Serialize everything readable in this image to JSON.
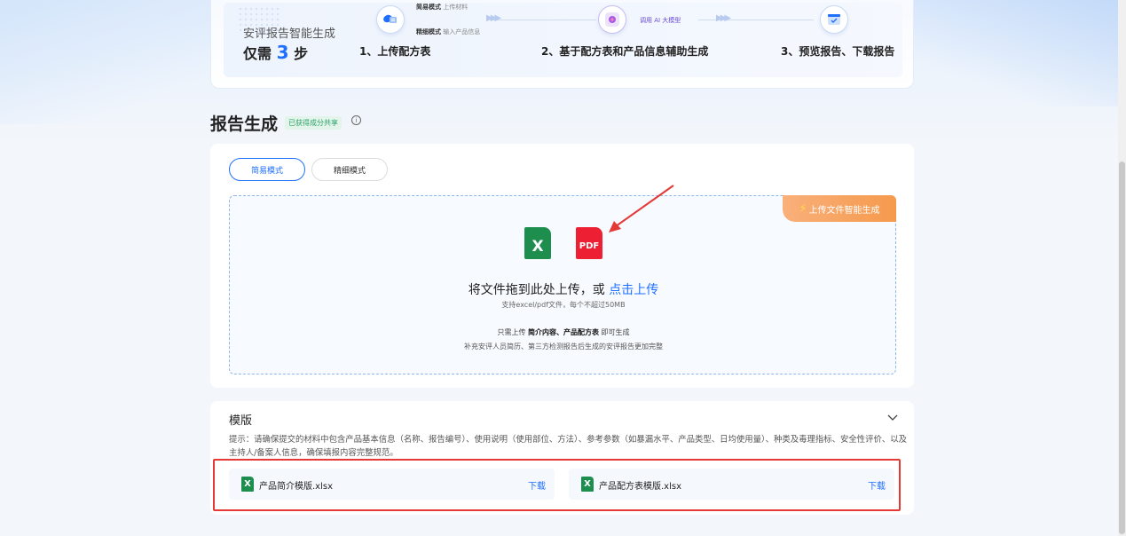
{
  "steps": {
    "title": "安评报告智能生成",
    "subtitle_prefix": "仅需",
    "subtitle_num": "3",
    "subtitle_suffix": "步",
    "step1_label": "1、上传配方表",
    "step2_label": "2、基于配方表和产品信息辅助生成",
    "step3_label": "3、预览报告、下载报告",
    "simple_mode_name": "简易模式",
    "simple_mode_desc": "上传材料",
    "fine_mode_name": "精细模式",
    "fine_mode_desc": "输入产品信息",
    "ai_text": "调用 AI 大模型"
  },
  "heading": {
    "title": "报告生成",
    "badge": "已获得成分共享",
    "info_icon": "i"
  },
  "upload": {
    "mode_simple": "简易模式",
    "mode_fine": "精细模式",
    "corner_tag": "上传文件智能生成",
    "excel_glyph": "X",
    "pdf_glyph": "PDF",
    "main_text": "将文件拖到此处上传，或",
    "main_link": "点击上传",
    "sub_text": "支持excel/pdf文件，每个不超过50MB",
    "note1_prefix": "只需上传",
    "note1_bold": "简介内容、产品配方表",
    "note1_suffix": "即可生成",
    "note2": "补充安评人员简历、第三方检测报告后生成的安评报告更加完整"
  },
  "template": {
    "title": "模版",
    "hint": "提示：请确保提交的材料中包含产品基本信息（名称、报告编号）、使用说明（使用部位、方法）、参考参数（如暴漏水平、产品类型、日均使用量）、种类及毒理指标、安全性评价、以及主持人/备案人信息，确保填报内容完整规范。",
    "files": [
      {
        "name": "产品简介模版.xlsx",
        "action": "下载",
        "icon": "X"
      },
      {
        "name": "产品配方表模版.xlsx",
        "action": "下载",
        "icon": "X"
      }
    ]
  },
  "colors": {
    "primary": "#1f6fff",
    "excel": "#1e8e4f",
    "pdf": "#ec1f33",
    "tag": "#f59a4d",
    "highlight": "#e53935"
  }
}
